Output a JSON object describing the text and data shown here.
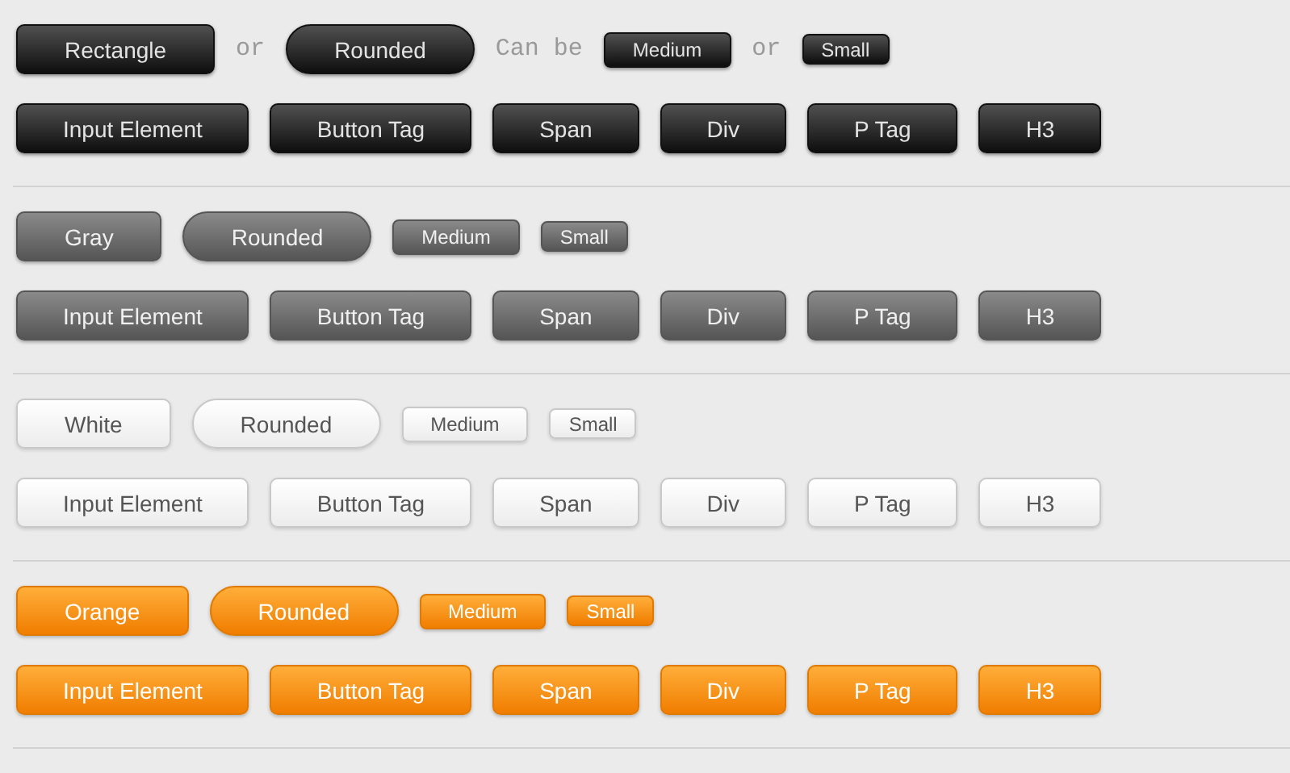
{
  "sections": [
    {
      "kind": "black",
      "row_1": [
        {
          "kind": "rectangle",
          "label": "Rectangle"
        },
        {
          "kind": "text",
          "label": "or"
        },
        {
          "kind": "rounded",
          "label": "Rounded"
        },
        {
          "kind": "text",
          "label": "Can be"
        },
        {
          "kind": "medium",
          "label": "Medium"
        },
        {
          "kind": "text",
          "label": "or"
        },
        {
          "kind": "small",
          "label": "Small"
        }
      ],
      "row_2": [
        "Input Element",
        "Button Tag",
        "Span",
        "Div",
        "P Tag",
        "H3"
      ]
    },
    {
      "kind": "gray",
      "row_1": [
        {
          "kind": "rectangle",
          "label": "Gray"
        },
        {
          "kind": "rounded",
          "label": "Rounded"
        },
        {
          "kind": "medium",
          "label": "Medium"
        },
        {
          "kind": "small",
          "label": "Small"
        }
      ],
      "row_2": [
        "Input Element",
        "Button Tag",
        "Span",
        "Div",
        "P Tag",
        "H3"
      ]
    },
    {
      "kind": "white",
      "row_1": [
        {
          "kind": "rectangle",
          "label": "White"
        },
        {
          "kind": "rounded",
          "label": "Rounded"
        },
        {
          "kind": "medium",
          "label": "Medium"
        },
        {
          "kind": "small",
          "label": "Small"
        }
      ],
      "row_2": [
        "Input Element",
        "Button Tag",
        "Span",
        "Div",
        "P Tag",
        "H3"
      ]
    },
    {
      "kind": "orange",
      "row_1": [
        {
          "kind": "rectangle",
          "label": "Orange"
        },
        {
          "kind": "rounded",
          "label": "Rounded"
        },
        {
          "kind": "medium",
          "label": "Medium"
        },
        {
          "kind": "small",
          "label": "Small"
        }
      ],
      "row_2": [
        "Input Element",
        "Button Tag",
        "Span",
        "Div",
        "P Tag",
        "H3"
      ]
    }
  ]
}
